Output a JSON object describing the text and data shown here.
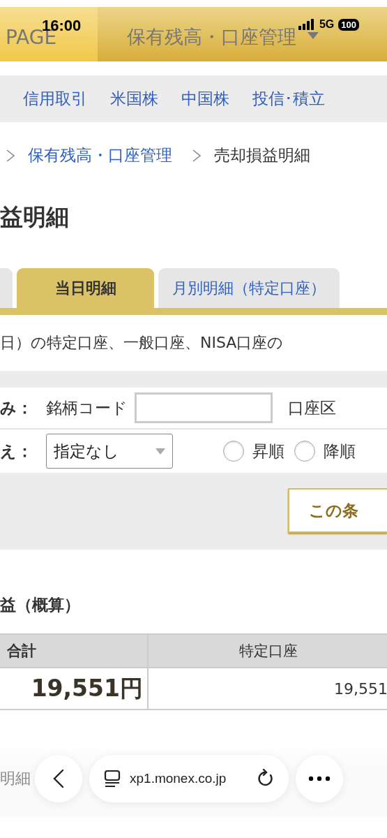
{
  "status_bar": {
    "time": "16:00",
    "network": "5G",
    "battery": "100"
  },
  "header": {
    "left": "PAGE",
    "title": "保有残高・口座管理"
  },
  "nav": [
    "信用取引",
    "米国株",
    "中国株",
    "投信･積立"
  ],
  "breadcrumb": [
    {
      "label": "保有残高・口座管理",
      "kind": "link"
    },
    {
      "label": "売却損益明細",
      "kind": "current"
    }
  ],
  "page_title": "益明細",
  "tabs": [
    {
      "label": "当日明細",
      "selected": true
    },
    {
      "label": "月別明細（特定口座）",
      "selected": false
    }
  ],
  "description": "日）の特定口座、一般口座、NISA口座の",
  "filter": {
    "label": "み：",
    "code_label": "銘柄コード",
    "account_label": "口座区"
  },
  "sort": {
    "label": "え：",
    "select": "指定なし",
    "options": [
      {
        "label": "昇順",
        "selected": false
      },
      {
        "label": "降順",
        "selected": false
      }
    ]
  },
  "search_button": "この条",
  "summary": {
    "heading": "益（概算）",
    "columns": [
      "合計",
      "特定口座"
    ],
    "values": [
      "19,551円",
      "19,551"
    ]
  },
  "next_heading": "明細",
  "browser": {
    "url": "xp1.monex.co.jp"
  }
}
